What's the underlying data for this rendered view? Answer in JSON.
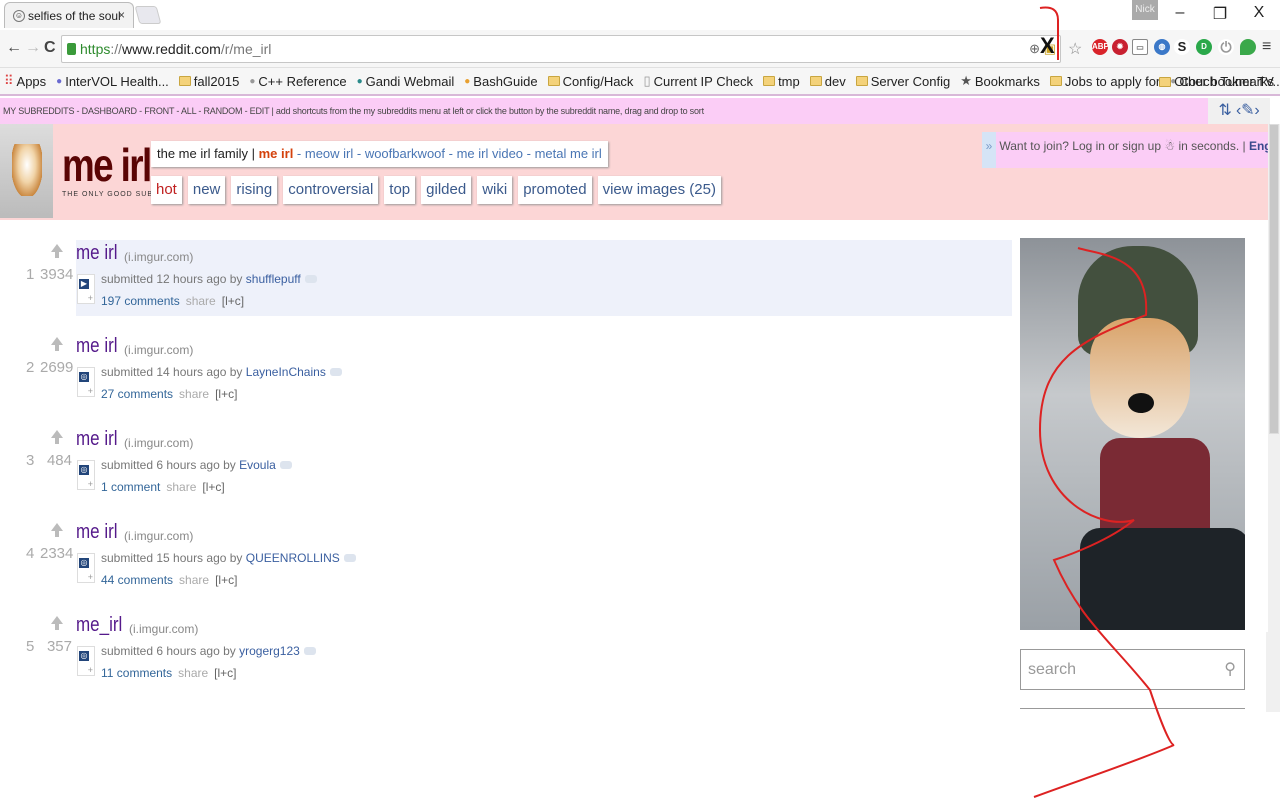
{
  "browser": {
    "tab_title": "selfies of the soul",
    "tab_close": "×",
    "user_badge": "Nick",
    "window_controls": {
      "minimize": "–",
      "restore": "❐",
      "close": "X"
    },
    "url": {
      "scheme": "https",
      "sep": "://",
      "host": "www.reddit.com",
      "path": "/r/me_irl"
    },
    "nav": {
      "back": "←",
      "forward": "→",
      "reload": "C"
    },
    "extension_x": "X",
    "bookmarks": [
      {
        "label": "Apps",
        "icon": "apps-grid-icon"
      },
      {
        "label": "InterVOL Health...",
        "icon": "site-icon"
      },
      {
        "label": "fall2015",
        "icon": "folder-icon"
      },
      {
        "label": "C++ Reference",
        "icon": "site-icon"
      },
      {
        "label": "Gandi Webmail",
        "icon": "site-icon"
      },
      {
        "label": "BashGuide",
        "icon": "site-icon"
      },
      {
        "label": "Config/Hack",
        "icon": "folder-icon"
      },
      {
        "label": "Current IP Check",
        "icon": "page-icon"
      },
      {
        "label": "tmp",
        "icon": "folder-icon"
      },
      {
        "label": "dev",
        "icon": "folder-icon"
      },
      {
        "label": "Server Config",
        "icon": "folder-icon"
      },
      {
        "label": "Bookmarks",
        "icon": "star-icon"
      },
      {
        "label": "Jobs to apply for",
        "icon": "folder-icon"
      },
      {
        "label": "Couch Tuner TV...",
        "icon": "site-icon"
      }
    ],
    "other_bookmarks": "Other bookmarks"
  },
  "srbar": {
    "text": "MY SUBREDDITS - DASHBOARD - FRONT - ALL - RANDOM - EDIT  |  add shortcuts from the my subreddits menu at left or click the button by the subreddit name, drag and drop to sort",
    "controls": "⇅ ‹✎›"
  },
  "header": {
    "logo": "me irl",
    "tagline": "THE ONLY GOOD SUB",
    "family_prefix": "the me irl family | ",
    "family_current": "me irl",
    "family_links": " - meow irl - woofbarkwoof - me irl video - metal me irl",
    "tabs": [
      "hot",
      "new",
      "rising",
      "controversial",
      "top",
      "gilded",
      "wiki",
      "promoted",
      "view images (25)"
    ],
    "join": {
      "chevron": "»",
      "text": "Want to join? Log in or sign up",
      "suffix": " in seconds. | ",
      "lang": "English",
      "sep": " | "
    }
  },
  "posts": [
    {
      "rank": "1",
      "score": "3934",
      "title": "me irl",
      "domain": "(i.imgur.com)",
      "submitted": "submitted 12 hours ago by ",
      "author": "shufflepuff",
      "comments": "197 comments",
      "share": "share",
      "lc": "[l+c]"
    },
    {
      "rank": "2",
      "score": "2699",
      "title": "me irl",
      "domain": "(i.imgur.com)",
      "submitted": "submitted 14 hours ago by ",
      "author": "LayneInChains",
      "comments": "27 comments",
      "share": "share",
      "lc": "[l+c]"
    },
    {
      "rank": "3",
      "score": "484",
      "title": "me irl",
      "domain": "(i.imgur.com)",
      "submitted": "submitted 6 hours ago by ",
      "author": "Evoula",
      "comments": "1 comment",
      "share": "share",
      "lc": "[l+c]"
    },
    {
      "rank": "4",
      "score": "2334",
      "title": "me irl",
      "domain": "(i.imgur.com)",
      "submitted": "submitted 15 hours ago by ",
      "author": "QUEENROLLINS",
      "comments": "44 comments",
      "share": "share",
      "lc": "[l+c]"
    },
    {
      "rank": "5",
      "score": "357",
      "title": "me_irl",
      "domain": "(i.imgur.com)",
      "submitted": "submitted 6 hours ago by ",
      "author": "yrogerg123",
      "comments": "11 comments",
      "share": "share",
      "lc": "[l+c]"
    }
  ],
  "sidebar": {
    "search_placeholder": "search"
  },
  "colors": {
    "annotation": "#d22222",
    "header_bg": "#fcd6d6",
    "srbar_bg": "#fbcdf6"
  }
}
